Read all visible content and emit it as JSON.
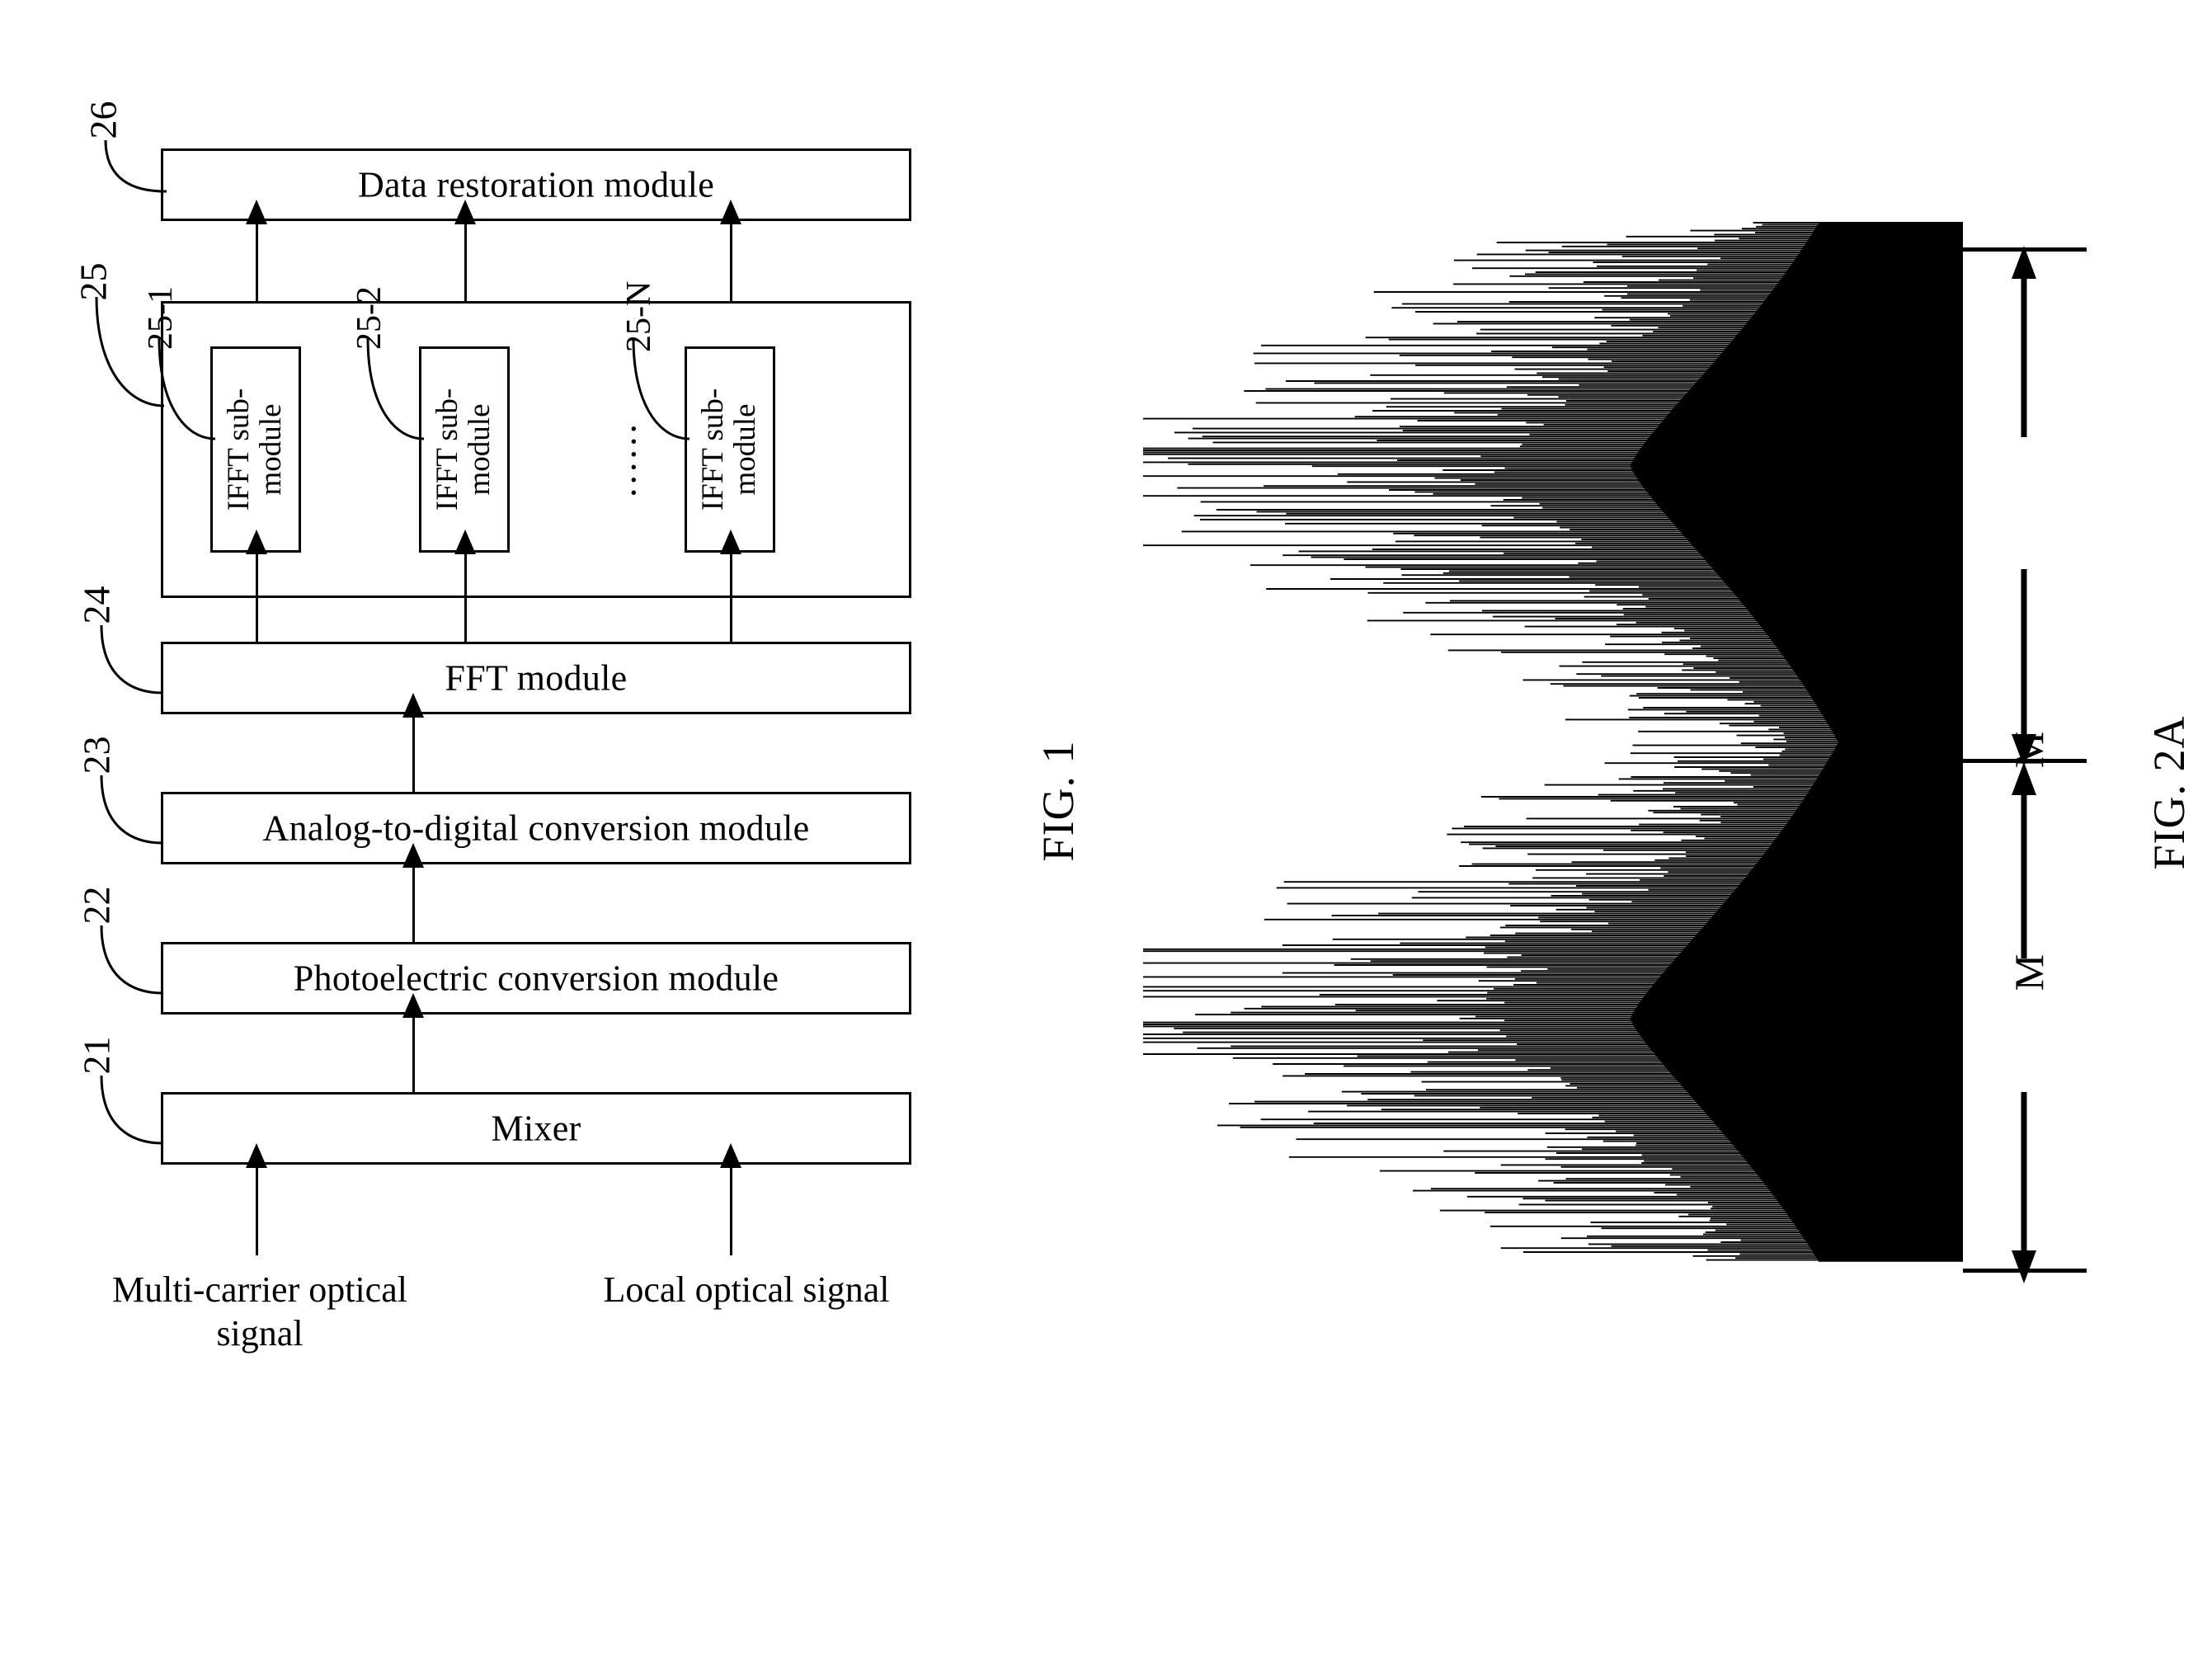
{
  "figures": [
    {
      "id": "fig1",
      "caption": "FIG. 1",
      "blocks": [
        {
          "ref": "26",
          "label": "Data restoration module"
        },
        {
          "ref": "25",
          "label": ""
        },
        {
          "ref": "24",
          "label": "FFT module"
        },
        {
          "ref": "23",
          "label": "Analog-to-digital conversion module"
        },
        {
          "ref": "22",
          "label": "Photoelectric conversion module"
        },
        {
          "ref": "21",
          "label": "Mixer"
        }
      ],
      "submodules": [
        {
          "ref": "25-1",
          "label_line1": "IFFT sub-",
          "label_line2": "module"
        },
        {
          "ref": "25-2",
          "label_line1": "IFFT sub-",
          "label_line2": "module"
        },
        {
          "ref": "25-N",
          "label_line1": "IFFT sub-",
          "label_line2": "module"
        }
      ],
      "ellipsis": "......",
      "inputs": [
        {
          "label": "Multi-carrier optical\nsignal"
        },
        {
          "label": "Local optical signal"
        }
      ]
    },
    {
      "id": "fig2a",
      "caption": "FIG. 2A",
      "dimension_labels": [
        "M",
        "M"
      ]
    }
  ],
  "chart_data": {
    "type": "line",
    "title": "FIG. 2A",
    "xlabel": "",
    "ylabel": "",
    "annotations": [
      "M",
      "M"
    ],
    "description": "Two-lobe optical spectrum envelope (dense noisy trace), symmetric about a central axis; each lobe spans a bandwidth labelled M.",
    "orientation": "rotated-90",
    "lobes": [
      {
        "name": "upper-lobe",
        "span_label": "M",
        "peak_position": 0.5
      },
      {
        "name": "lower-lobe",
        "span_label": "M",
        "peak_position": 0.5
      }
    ]
  },
  "colors": {
    "ink": "#000000",
    "paper": "#ffffff"
  }
}
